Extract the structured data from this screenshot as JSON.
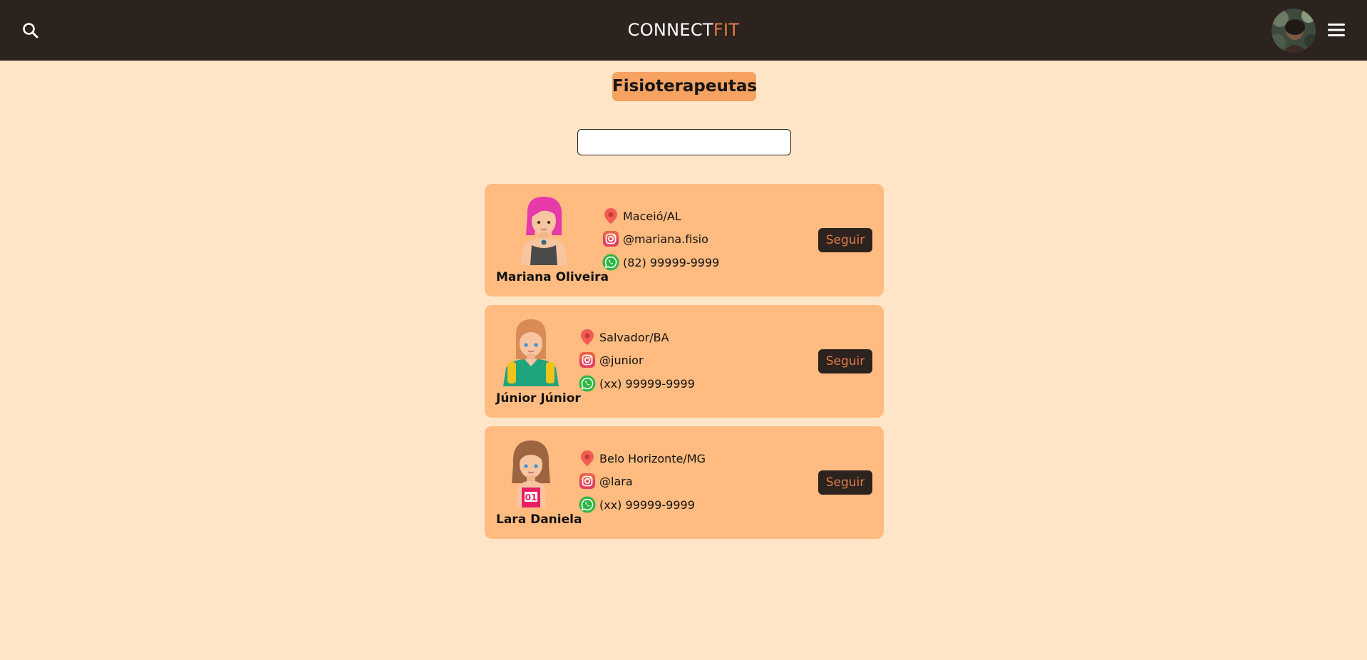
{
  "header": {
    "brand_main": "CONNECT",
    "brand_accent": "FIT",
    "search_icon": "search-icon",
    "menu_icon": "hamburger-menu-icon",
    "avatar": "user-avatar"
  },
  "page": {
    "title": "Fisioterapeutas",
    "search": {
      "value": "",
      "placeholder": ""
    }
  },
  "professionals": [
    {
      "name": "Mariana Oliveira",
      "location": "Maceió/AL",
      "instagram": "@mariana.fisio",
      "whatsapp": "(82) 99999-9999",
      "follow_label": "Seguir",
      "avatar": "woman-pink-hair-avatar"
    },
    {
      "name": "Júnior Júnior",
      "location": "Salvador/BA",
      "instagram": "@junior",
      "whatsapp": "(xx) 99999-9999",
      "follow_label": "Seguir",
      "avatar": "woman-teal-shirt-avatar"
    },
    {
      "name": "Lara Daniela",
      "location": "Belo Horizonte/MG",
      "instagram": "@lara",
      "whatsapp": "(xx) 99999-9999",
      "follow_label": "Seguir",
      "avatar": "girl-number-01-avatar"
    }
  ],
  "colors": {
    "header_bg": "#2c221e",
    "page_bg": "#ffe5c7",
    "card_bg": "#ffbb80",
    "title_bg": "#f6a261",
    "accent": "#e07c4a"
  }
}
